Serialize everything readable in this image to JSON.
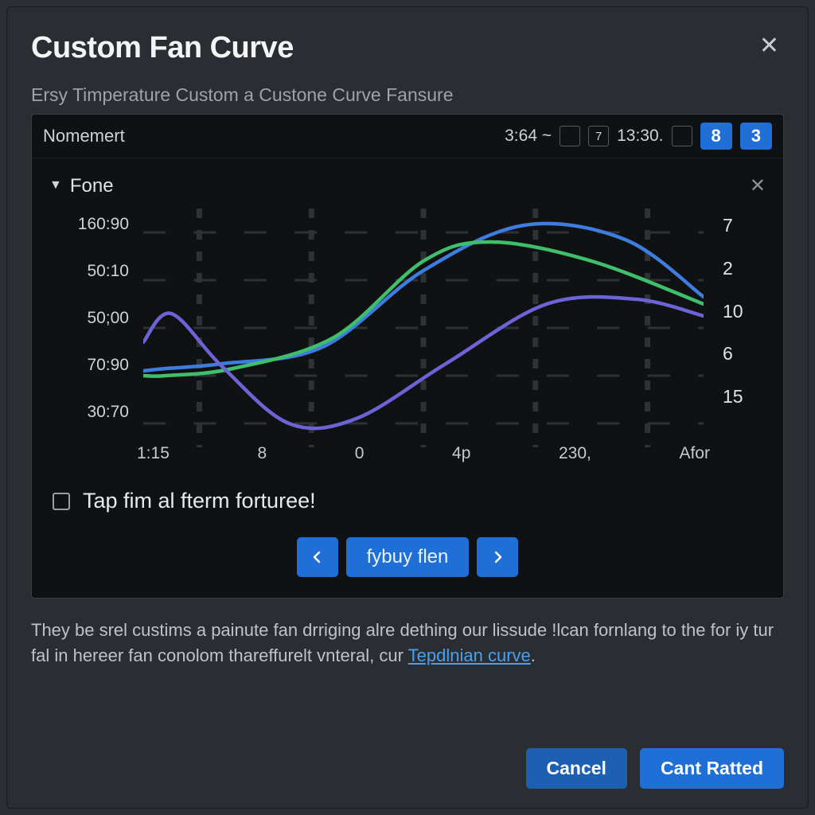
{
  "modal": {
    "title": "Custom Fan Curve",
    "subtitle": "Ersy Timperature Custom a Custone Curve Fansure"
  },
  "toolbar": {
    "name_label": "Nomemert",
    "value_a": "3:64 ~",
    "box_a": "",
    "box_b": "7",
    "time": "13:30.",
    "box_c": "",
    "badge_a": "8",
    "badge_b": "3"
  },
  "section": {
    "title": "Fone"
  },
  "chart_data": {
    "type": "line",
    "y_left_ticks": [
      "160:90",
      "50:10",
      "50;00",
      "70:90",
      "30:70"
    ],
    "x_ticks": [
      "1:15",
      "8",
      "0",
      "4p",
      "230,",
      "Afor"
    ],
    "y_right_ticks": [
      "7",
      "2",
      "10",
      "6",
      "15"
    ],
    "series": [
      {
        "name": "curve-blue",
        "color": "#3d7de0",
        "x": [
          0,
          4,
          14,
          32,
          50,
          68,
          86,
          100
        ],
        "y": [
          32,
          33,
          35,
          42,
          74,
          93,
          87,
          63
        ]
      },
      {
        "name": "curve-green",
        "color": "#3fbf6c",
        "x": [
          0,
          4,
          16,
          34,
          50,
          62,
          80,
          100
        ],
        "y": [
          30,
          30,
          33,
          46,
          78,
          86,
          78,
          60
        ]
      },
      {
        "name": "curve-violet",
        "color": "#6c63d6",
        "x": [
          0,
          5,
          14,
          26,
          38,
          54,
          72,
          88,
          100
        ],
        "y": [
          44,
          56,
          34,
          10,
          12,
          35,
          60,
          62,
          55
        ]
      }
    ]
  },
  "checkbox": {
    "label": "Tap fim al fterm forturee!"
  },
  "pager": {
    "main_label": "fybuy flen"
  },
  "description": {
    "text_a": "They be srel custims a painute fan drriging alre dething our lissude !lcan fornlang to the for iy tur fal in hereer fan conolom thareffurelt vnteral, cur ",
    "link": "Tepdlnian curve",
    "text_b": "."
  },
  "footer": {
    "cancel": "Cancel",
    "confirm": "Cant Ratted"
  }
}
